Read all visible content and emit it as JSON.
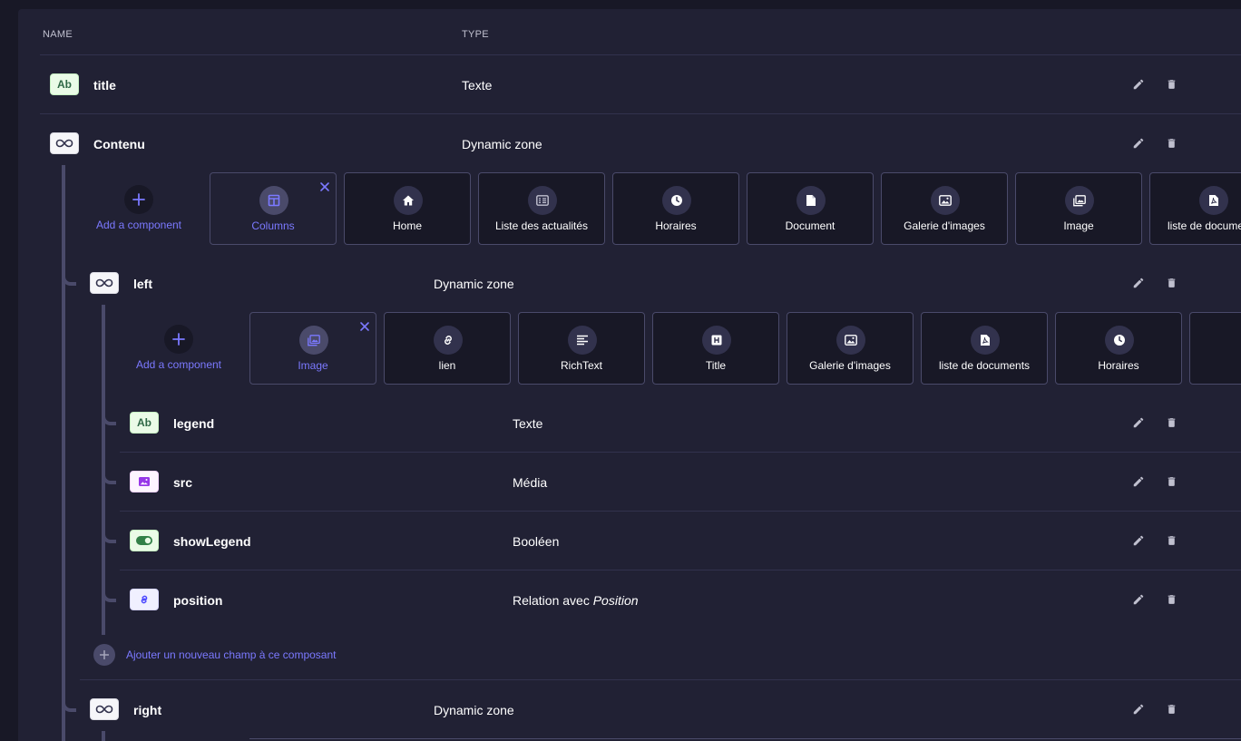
{
  "table": {
    "col_name": "NAME",
    "col_type": "TYPE"
  },
  "fields": {
    "title": {
      "name": "title",
      "type": "Texte",
      "badge": "Ab"
    },
    "contenu": {
      "name": "Contenu",
      "type": "Dynamic zone"
    },
    "left": {
      "name": "left",
      "type": "Dynamic zone"
    },
    "legend": {
      "name": "legend",
      "type": "Texte",
      "badge": "Ab"
    },
    "src": {
      "name": "src",
      "type": "Média"
    },
    "showLegend": {
      "name": "showLegend",
      "type": "Booléen"
    },
    "position": {
      "name": "position",
      "type_prefix": "Relation avec",
      "type_target": "Position"
    },
    "right": {
      "name": "right",
      "type": "Dynamic zone"
    }
  },
  "contenu_zone": {
    "add_label": "Add a component",
    "components": [
      {
        "label": "Columns",
        "icon": "columns-icon",
        "active": true
      },
      {
        "label": "Home",
        "icon": "home-icon"
      },
      {
        "label": "Liste des actualités",
        "icon": "news-list-icon"
      },
      {
        "label": "Horaires",
        "icon": "clock-icon"
      },
      {
        "label": "Document",
        "icon": "file-icon"
      },
      {
        "label": "Galerie d'images",
        "icon": "picture-icon"
      },
      {
        "label": "Image",
        "icon": "images-icon"
      },
      {
        "label": "liste de documents",
        "icon": "file-pdf-icon"
      }
    ]
  },
  "left_zone": {
    "add_label": "Add a component",
    "components": [
      {
        "label": "Image",
        "icon": "images-icon",
        "active": true
      },
      {
        "label": "lien",
        "icon": "link-icon"
      },
      {
        "label": "RichText",
        "icon": "align-left-icon"
      },
      {
        "label": "Title",
        "icon": "heading-icon"
      },
      {
        "label": "Galerie d'images",
        "icon": "picture-icon"
      },
      {
        "label": "liste de documents",
        "icon": "file-pdf-icon"
      },
      {
        "label": "Horaires",
        "icon": "clock-icon"
      },
      {
        "label": "",
        "icon": ""
      }
    ]
  },
  "add_field_label": "Ajouter un nouveau champ à ce composant",
  "colors": {
    "background": "#181826",
    "panel": "#212134",
    "accent": "#7b79ff",
    "separator": "#32324d",
    "tree_line": "#4a4a6a"
  }
}
